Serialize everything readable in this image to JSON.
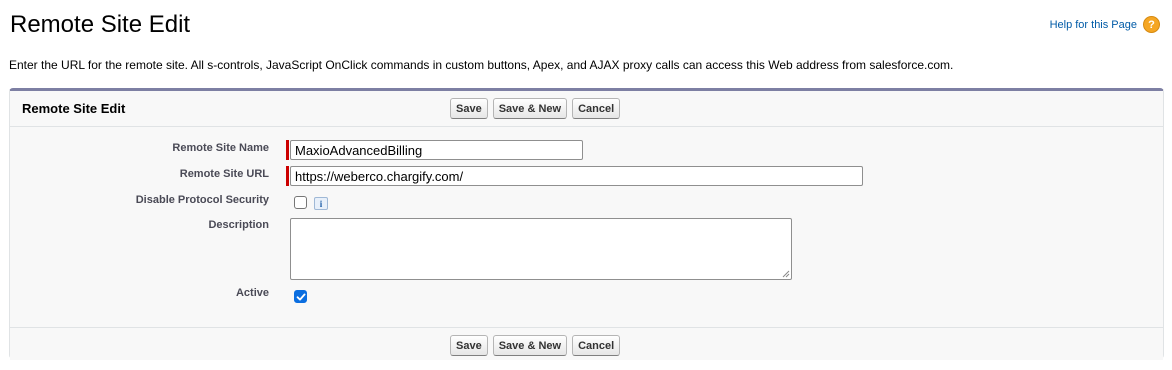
{
  "header": {
    "title": "Remote Site Edit",
    "help_label": "Help for this Page",
    "help_icon": "question-icon"
  },
  "intro_text": "Enter the URL for the remote site. All s-controls, JavaScript OnClick commands in custom buttons, Apex, and AJAX proxy calls can access this Web address from salesforce.com.",
  "block": {
    "title": "Remote Site Edit",
    "buttons": {
      "save": "Save",
      "save_new": "Save & New",
      "cancel": "Cancel"
    }
  },
  "form": {
    "remote_site_name": {
      "label": "Remote Site Name",
      "value": "MaxioAdvancedBilling",
      "required": true
    },
    "remote_site_url": {
      "label": "Remote Site URL",
      "value": "https://weberco.chargify.com/",
      "required": true
    },
    "disable_protocol_security": {
      "label": "Disable Protocol Security",
      "checked": false,
      "info_icon": "info-icon",
      "info_glyph": "i"
    },
    "description": {
      "label": "Description",
      "value": ""
    },
    "active": {
      "label": "Active",
      "checked": true
    }
  },
  "colors": {
    "accent_border": "#7d7fa3",
    "required_bar": "#cc0000",
    "link": "#015ba7",
    "checkbox_checked": "#0b6ee0"
  }
}
